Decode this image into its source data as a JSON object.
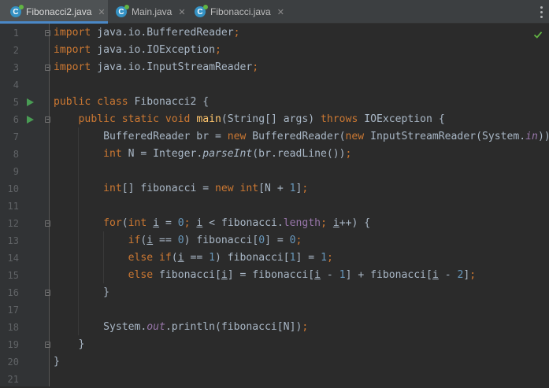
{
  "tabs": [
    {
      "label": "Fibonacci2.java",
      "active": true
    },
    {
      "label": "Main.java",
      "active": false
    },
    {
      "label": "Fibonacci.java",
      "active": false
    }
  ],
  "file_icon_letter": "C",
  "close_glyph": "✕",
  "status_icon": "check-icon",
  "colors": {
    "keyword": "#cc7832",
    "method": "#ffc66d",
    "number": "#6897bb",
    "static_field": "#9876aa",
    "text": "#a9b7c6",
    "run": "#499c54",
    "tab_accent": "#4a88c7"
  },
  "lines": [
    {
      "n": "1",
      "code": "import java.io.BufferedReader;"
    },
    {
      "n": "2",
      "code": "import java.io.IOException;"
    },
    {
      "n": "3",
      "code": "import java.io.InputStreamReader;"
    },
    {
      "n": "4",
      "code": ""
    },
    {
      "n": "5",
      "code": "public class Fibonacci2 {"
    },
    {
      "n": "6",
      "code": "    public static void main(String[] args) throws IOException {"
    },
    {
      "n": "7",
      "code": "        BufferedReader br = new BufferedReader(new InputStreamReader(System.in));"
    },
    {
      "n": "8",
      "code": "        int N = Integer.parseInt(br.readLine());"
    },
    {
      "n": "9",
      "code": ""
    },
    {
      "n": "10",
      "code": "        int[] fibonacci = new int[N + 1];"
    },
    {
      "n": "11",
      "code": ""
    },
    {
      "n": "12",
      "code": "        for(int i = 0; i < fibonacci.length; i++) {"
    },
    {
      "n": "13",
      "code": "            if(i == 0) fibonacci[0] = 0;"
    },
    {
      "n": "14",
      "code": "            else if(i == 1) fibonacci[1] = 1;"
    },
    {
      "n": "15",
      "code": "            else fibonacci[i] = fibonacci[i - 1] + fibonacci[i - 2];"
    },
    {
      "n": "16",
      "code": "        }"
    },
    {
      "n": "17",
      "code": ""
    },
    {
      "n": "18",
      "code": "        System.out.println(fibonacci[N]);"
    },
    {
      "n": "19",
      "code": "    }"
    },
    {
      "n": "20",
      "code": "}"
    },
    {
      "n": "21",
      "code": ""
    }
  ]
}
